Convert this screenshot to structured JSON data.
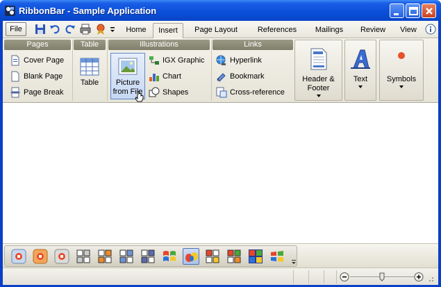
{
  "window": {
    "title": "RibbonBar - Sample Application",
    "controls": [
      "minimize",
      "maximize",
      "close"
    ]
  },
  "tabs": {
    "file_label": "File",
    "items": [
      "Home",
      "Insert",
      "Page Layout",
      "References",
      "Mailings",
      "Review",
      "View"
    ],
    "active": "Insert"
  },
  "quick_access": [
    "save-icon",
    "undo-icon",
    "redo-icon",
    "print-icon",
    "ribbon-award-icon",
    "qat-dropdown-icon"
  ],
  "ribbon": {
    "groups": {
      "pages": {
        "title": "Pages",
        "items": [
          "Cover Page",
          "Blank Page",
          "Page Break"
        ]
      },
      "table": {
        "title": "Table",
        "button": "Table"
      },
      "illustrations": {
        "title": "Illustrations",
        "picture_line1": "Picture",
        "picture_line2": "from File",
        "items": [
          "IGX Graphic",
          "Chart",
          "Shapes"
        ]
      },
      "links": {
        "title": "Links",
        "items": [
          "Hyperlink",
          "Bookmark",
          "Cross-reference"
        ]
      },
      "header_footer": {
        "line1": "Header &",
        "line2": "Footer"
      },
      "text": {
        "label": "Text"
      },
      "symbols": {
        "label": "Symbols"
      }
    }
  },
  "toolstrip": {
    "buttons": [
      "office-2007-blue",
      "office-2007-orange",
      "office-2007-silver",
      "office-2003-silver",
      "office-2003-orange",
      "office-2003-blue",
      "office-2003-olive",
      "windows-xp-icon",
      "vista-icon",
      "windows-flag-1",
      "windows-flag-2",
      "windows-flag-3",
      "windows-flag-4"
    ],
    "pressed_index": 8
  },
  "colors": {
    "titlebar": "#0a4ed8",
    "ribbon_header": "#8a8a76",
    "selection": "#c6d8f3"
  }
}
